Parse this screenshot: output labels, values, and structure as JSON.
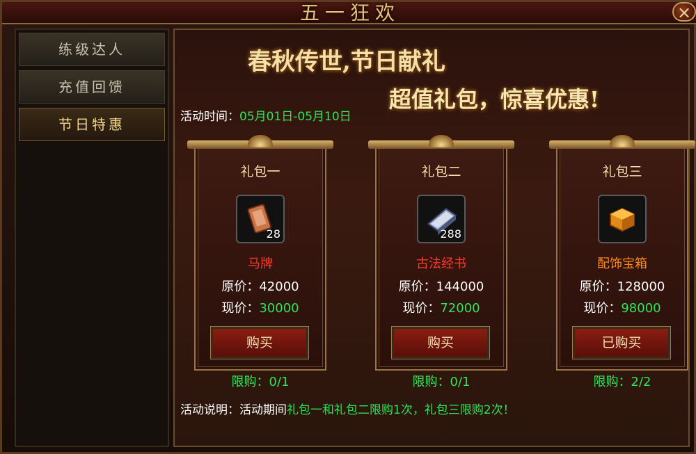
{
  "window": {
    "title": "五一狂欢",
    "close_label": "×"
  },
  "sidebar": {
    "items": [
      {
        "label": "练级达人",
        "active": false
      },
      {
        "label": "充值回馈",
        "active": false
      },
      {
        "label": "节日特惠",
        "active": true
      }
    ]
  },
  "banner": {
    "line1": "春秋传世,节日献礼",
    "line2": "超值礼包，惊喜优惠!"
  },
  "event_time": {
    "label": "活动时间：",
    "value": "05月01日-05月10日"
  },
  "packages": [
    {
      "title": "礼包一",
      "item_name": "马牌",
      "item_color": "#ff3a2a",
      "count": "28",
      "icon": "horse-token-icon",
      "orig_label": "原价：",
      "orig_price": "42000",
      "now_label": "现价：",
      "now_price": "30000",
      "button": "购买",
      "limit": "限购：0/1"
    },
    {
      "title": "礼包二",
      "item_name": "古法经书",
      "item_color": "#ff3a2a",
      "count": "288",
      "icon": "scripture-book-icon",
      "orig_label": "原价：",
      "orig_price": "144000",
      "now_label": "现价：",
      "now_price": "72000",
      "button": "购买",
      "limit": "限购：0/1"
    },
    {
      "title": "礼包三",
      "item_name": "配饰宝箱",
      "item_color": "#ff8a1a",
      "count": "",
      "icon": "treasure-box-icon",
      "orig_label": "原价：",
      "orig_price": "128000",
      "now_label": "现价：",
      "now_price": "98000",
      "button": "已购买",
      "limit": "限购：2/2"
    }
  ],
  "description": {
    "label": "活动说明：活动期间",
    "text": "礼包一和礼包二限购1次，礼包三限购2次！"
  },
  "colors": {
    "accent_green": "#2fe35a",
    "gold": "#f2d58a",
    "button_red": "#8a1e12"
  }
}
